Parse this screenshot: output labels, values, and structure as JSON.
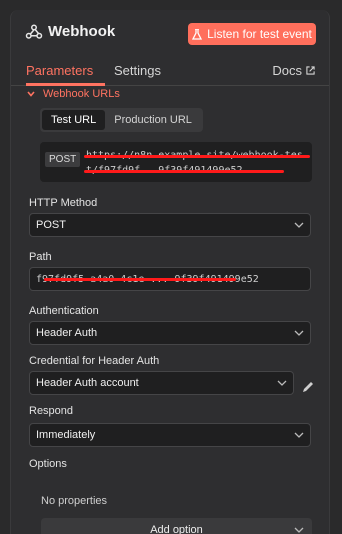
{
  "node": {
    "title": "Webhook",
    "listen_button": "Listen for test event"
  },
  "tabs": [
    {
      "label": "Parameters"
    },
    {
      "label": "Settings"
    }
  ],
  "docs_label": "Docs",
  "webhook_urls": {
    "section_label": "Webhook URLs",
    "tabs": [
      {
        "label": "Test URL"
      },
      {
        "label": "Production URL"
      }
    ],
    "method": "POST",
    "url": "https://n8n.example.site/webhook-test/f97fd9f...9f39f491499e52"
  },
  "fields": {
    "http_method": {
      "label": "HTTP Method",
      "value": "POST"
    },
    "path": {
      "label": "Path",
      "value": "f97fd9f5-a4a0-4c1e-...-9f39f491499e52"
    },
    "authentication": {
      "label": "Authentication",
      "value": "Header Auth"
    },
    "credential": {
      "label": "Credential for Header Auth",
      "value": "Header Auth account"
    },
    "respond": {
      "label": "Respond",
      "value": "Immediately"
    }
  },
  "options": {
    "label": "Options",
    "empty_text": "No properties",
    "add_button": "Add option"
  },
  "colors": {
    "accent": "#ff6f5c",
    "background": "#2e2e30",
    "input_bg": "#1f1f20"
  }
}
